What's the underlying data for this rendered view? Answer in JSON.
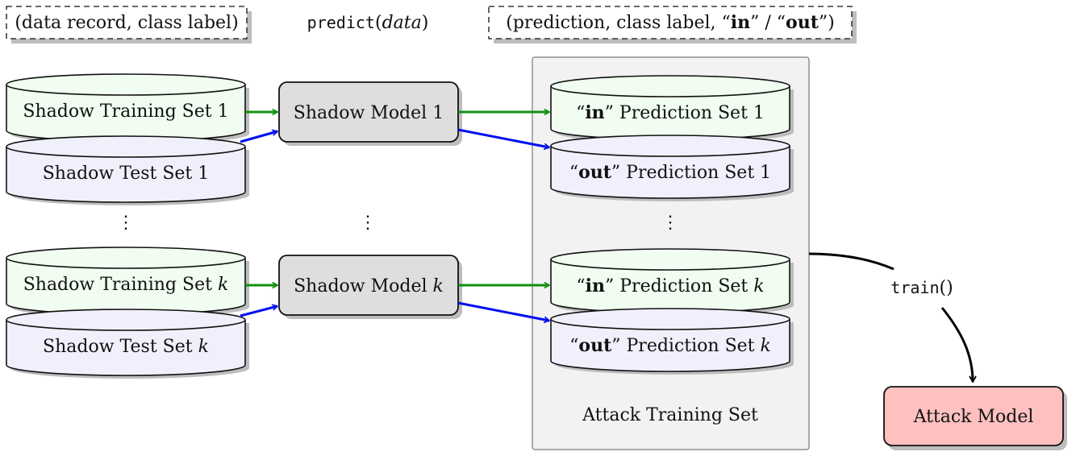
{
  "legend": {
    "input_record": "(data record, class label)",
    "predict_fn": "predict",
    "predict_arg": "data",
    "output_record_prefix": "(prediction, class label, ",
    "output_in": "in",
    "output_sep": " / ",
    "output_out": "out",
    "output_record_suffix": ")"
  },
  "shadow_groups": [
    {
      "index": "1",
      "index_italic": false,
      "training_set": "Shadow Training Set",
      "test_set": "Shadow Test Set",
      "model": "Shadow Model",
      "in_prediction": "Prediction Set",
      "out_prediction": "Prediction Set"
    },
    {
      "index": "k",
      "index_italic": true,
      "training_set": "Shadow Training Set",
      "test_set": "Shadow Test Set",
      "model": "Shadow Model",
      "in_prediction": "Prediction Set",
      "out_prediction": "Prediction Set"
    }
  ],
  "in_label": "in",
  "out_label": "out",
  "ellipsis": "⋮",
  "attack_training_set": "Attack Training Set",
  "train_fn": "train",
  "attack_model": "Attack Model",
  "colors": {
    "training_fill": "#f0fdf0",
    "test_fill": "#f0f0fd",
    "model_fill": "#dedede",
    "attack_model_fill": "#ffc0c0",
    "attack_set_fill": "#f2f2f2",
    "in_arrow": "#109010",
    "out_arrow": "#0010f0",
    "shadow": "#bdbdbd"
  }
}
